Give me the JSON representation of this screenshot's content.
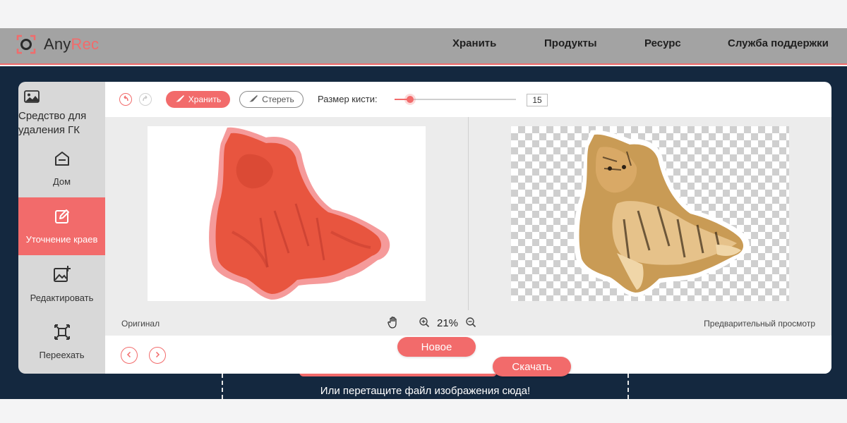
{
  "app": {
    "logo_any": "Any",
    "logo_rec": "Rec"
  },
  "nav": {
    "items": [
      "Хранить",
      "Продукты",
      "Ресурс",
      "Служба поддержки"
    ]
  },
  "sidebar": {
    "title": "Средство для удаления ГК",
    "title_icon": "image-icon",
    "items": [
      {
        "label": "Дом",
        "icon": "home-icon"
      },
      {
        "label": "Уточнение краев",
        "icon": "edit-icon"
      },
      {
        "label": "Редактировать",
        "icon": "image-edit-icon"
      },
      {
        "label": "Переехать",
        "icon": "move-icon"
      }
    ]
  },
  "toolbar": {
    "keep_label": "Хранить",
    "erase_label": "Стереть",
    "brush_label": "Размер кисти:",
    "brush_size": "15"
  },
  "status": {
    "original_label": "Оригинал",
    "zoom_percent": "21%",
    "preview_label": "Предварительный просмотр"
  },
  "footer": {
    "new_label": "Новое",
    "download_label": "Скачать"
  },
  "page": {
    "drop_text": "Или перетащите файл изображения сюда!"
  },
  "colors": {
    "accent": "#f26b6b",
    "header_bg": "#a3a3a3",
    "page_dark": "#14283f"
  }
}
